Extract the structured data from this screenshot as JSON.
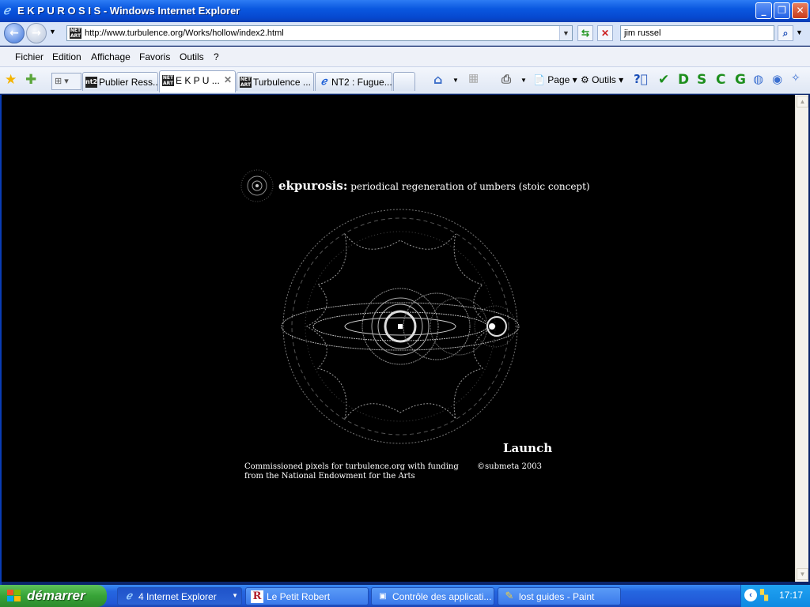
{
  "window": {
    "title": "E K P U R O S I S - Windows Internet Explorer"
  },
  "address": {
    "url": "http://www.turbulence.org/Works/hollow/index2.html",
    "search_value": "jim russel"
  },
  "menu": [
    "Fichier",
    "Edition",
    "Affichage",
    "Favoris",
    "Outils",
    "?"
  ],
  "tabs": [
    {
      "label": "Publier Ress...",
      "fav": "nt2",
      "active": false
    },
    {
      "label": "E K P U ...",
      "fav": "NET ART",
      "active": true
    },
    {
      "label": "Turbulence ...",
      "fav": "NET ART",
      "active": false
    },
    {
      "label": "NT2 : Fugue...",
      "fav": "ie",
      "active": false
    }
  ],
  "toolbar": {
    "page_label": "Page",
    "tools_label": "Outils",
    "letters": [
      "D",
      "S",
      "C",
      "G"
    ]
  },
  "page": {
    "title_bold": "ekpurosis:",
    "title_rest": " periodical regeneration of umbers (stoic concept)",
    "launch": "Launch",
    "credits_line1": "Commissioned pixels for turbulence.org with funding",
    "credits_line2": "from the National Endowment for the Arts",
    "copyright": "©submeta 2003"
  },
  "taskbar": {
    "start": "démarrer",
    "tasks": [
      {
        "label": "4 Internet Explorer",
        "icon": "ie-icon",
        "active": true
      },
      {
        "label": "Le Petit Robert",
        "icon": "robert-icon",
        "active": false
      },
      {
        "label": "Contrôle des applicati...",
        "icon": "app-control-icon",
        "active": false
      },
      {
        "label": "lost guides - Paint",
        "icon": "paint-icon",
        "active": false
      }
    ],
    "clock": "17:17"
  },
  "colors": {
    "accent": "#0a58e0",
    "content_bg": "#000000",
    "start_green": "#37a337"
  }
}
